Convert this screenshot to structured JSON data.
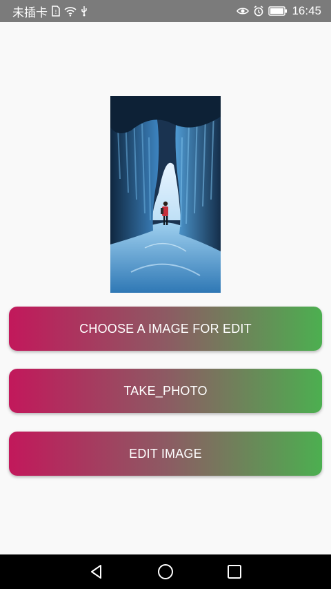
{
  "status_bar": {
    "carrier": "未插卡",
    "time": "16:45",
    "icons": [
      "sim-icon",
      "wifi-icon",
      "usb-icon",
      "eye-icon",
      "alarm-icon",
      "battery-icon"
    ]
  },
  "preview": {
    "icon": "ice-cave-photo"
  },
  "buttons": {
    "choose_label": "CHOOSE A IMAGE FOR EDIT",
    "take_photo_label": "TAKE_PHOTO",
    "edit_label": "EDIT IMAGE"
  },
  "nav": {
    "icons": [
      "back-icon",
      "home-icon",
      "recents-icon"
    ]
  },
  "colors": {
    "gradient_start": "#c2185b",
    "gradient_end": "#4caf50",
    "status_bar_bg": "#7b7b7b",
    "nav_bar_bg": "#000000"
  }
}
